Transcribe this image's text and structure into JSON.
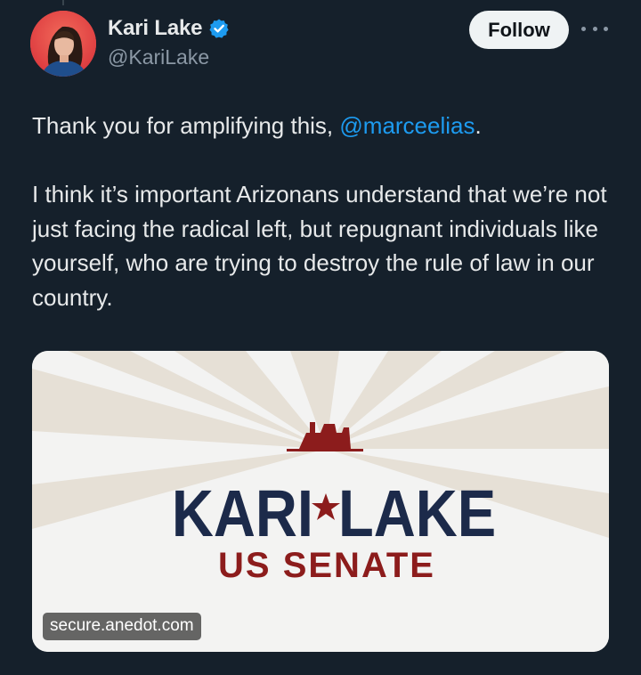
{
  "post": {
    "author": {
      "display_name": "Kari Lake",
      "handle": "@KariLake",
      "verified": true
    },
    "follow_label": "Follow",
    "text": {
      "p1_before": "Thank you for amplifying this, ",
      "p1_mention": "@marceelias",
      "p1_after": ".",
      "p2": "I think it’s important Arizonans understand that we’re not just facing the radical left, but repugnant individuals like yourself, who are trying to destroy the rule of law in our country."
    },
    "card": {
      "domain": "secure.anedot.com",
      "logo_line1_left": "KARI",
      "logo_line1_right": "LAKE",
      "logo_line2": "US SENATE"
    }
  },
  "colors": {
    "background": "#15202b",
    "accent_link": "#1d9bf0",
    "verified_badge": "#1d9bf0",
    "logo_navy": "#1c2a4a",
    "logo_red": "#8c1c1c"
  },
  "icons": {
    "verified": "verified-badge-icon",
    "more": "more-options-icon"
  }
}
